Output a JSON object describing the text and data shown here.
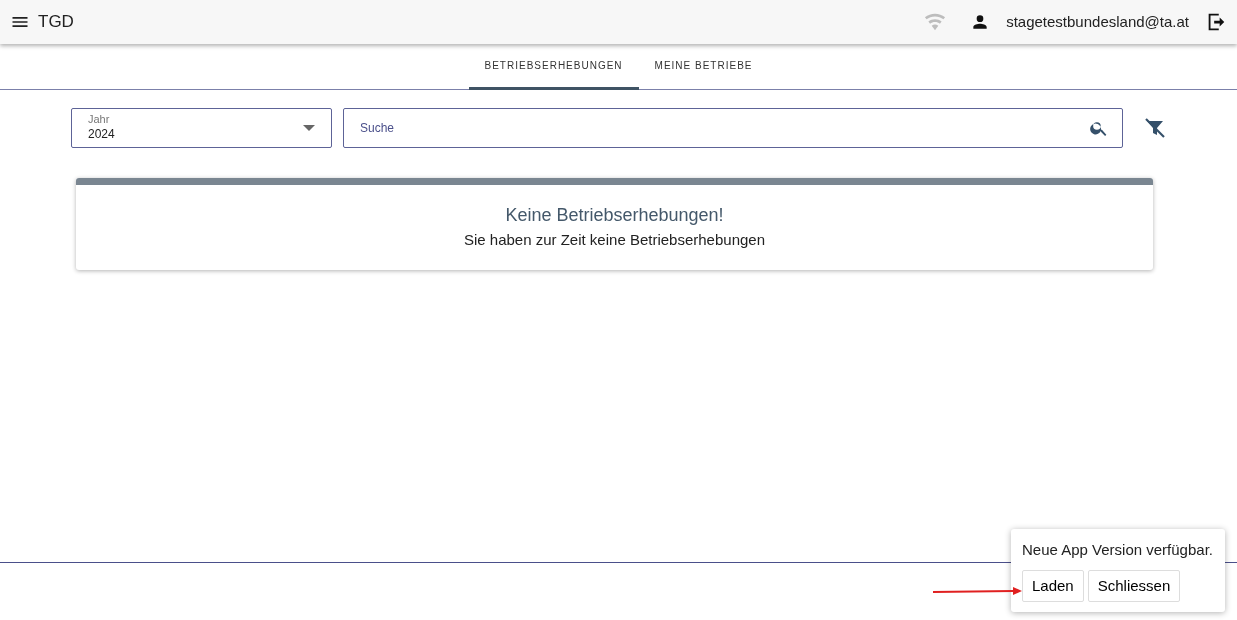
{
  "app_bar": {
    "title": "TGD",
    "user": "stagetestbundesland@ta.at",
    "online": false
  },
  "tabs": [
    {
      "label": "BETRIEBSERHEBUNGEN",
      "selected": true
    },
    {
      "label": "MEINE BETRIEBE",
      "selected": false
    }
  ],
  "filters": {
    "year": {
      "label": "Jahr",
      "value": "2024"
    },
    "search": {
      "placeholder": "Suche"
    }
  },
  "empty_state": {
    "title": "Keine Betriebserhebungen!",
    "message": "Sie haben zur Zeit keine Betriebserhebungen"
  },
  "update_popup": {
    "message": "Neue App Version verfügbar.",
    "buttons": [
      {
        "label": "Laden"
      },
      {
        "label": "Schliessen"
      }
    ]
  },
  "annotation_arrow": true
}
